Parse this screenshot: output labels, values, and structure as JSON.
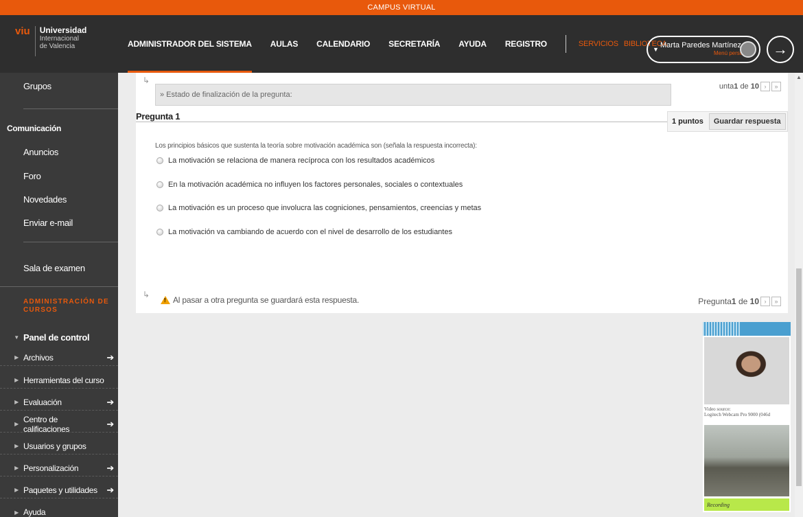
{
  "topbar": {
    "title": "CAMPUS VIRTUAL"
  },
  "logo": {
    "mark": "viu",
    "line1": "Universidad",
    "line2": "Internacional",
    "line3": "de Valencia"
  },
  "nav": {
    "items": [
      "ADMINISTRADOR DEL SISTEMA",
      "AULAS",
      "CALENDARIO",
      "SECRETARÍA",
      "AYUDA",
      "REGISTRO"
    ],
    "extras": [
      "SERVICIOS",
      "BIBLIOTECA"
    ]
  },
  "user": {
    "name": "Marta Paredes Martínez",
    "menu": "Menú personal"
  },
  "sidebar": {
    "groups_link": "Grupos",
    "comms_heading": "Comunicación",
    "comms": [
      "Anuncios",
      "Foro",
      "Novedades",
      "Enviar e-mail"
    ],
    "exam_room": "Sala de examen",
    "admin_heading": "ADMINISTRACIÓN DE CURSOS",
    "control_panel": "Panel de control",
    "cp_items": [
      {
        "label": "Archivos",
        "has_arrow": true
      },
      {
        "label": "Herramientas del curso",
        "has_arrow": false
      },
      {
        "label": "Evaluación",
        "has_arrow": true
      },
      {
        "label": "Centro de calificaciones",
        "has_arrow": true
      },
      {
        "label": "Usuarios y grupos",
        "has_arrow": false
      },
      {
        "label": "Personalización",
        "has_arrow": true
      },
      {
        "label": "Paquetes y utilidades",
        "has_arrow": true
      },
      {
        "label": "Ayuda",
        "has_arrow": false
      }
    ]
  },
  "question": {
    "status_label": "» Estado de finalización de la pregunta:",
    "nav_top_prefix": "unta",
    "nav_bottom_prefix": "Pregunta",
    "current": "1",
    "of_word": "de",
    "total": "10",
    "title": "Pregunta 1",
    "points": "1 puntos",
    "save_button": "Guardar respuesta",
    "prompt": "Los principios básicos que sustenta la teoría sobre motivación académica son (señala la respuesta incorrecta):",
    "options": [
      "La motivación se relaciona de manera recíproca con los resultados académicos",
      "En la motivación académica no influyen los factores personales, sociales o contextuales",
      "La motivación es un proceso que involucra las cogniciones, pensamientos, creencias y metas",
      "La motivación va cambiando de acuerdo con el nivel de desarrollo de los estudiantes"
    ],
    "warning": "Al pasar a otra pregunta se guardará esta respuesta."
  },
  "proctor": {
    "video_source_label": "Video source:",
    "video_source_value": "Logitech Webcam Pro 9000 (046d",
    "recording": "Recording"
  },
  "colors": {
    "accent": "#e8590c",
    "header_bg": "#2e2e2e",
    "sidebar_bg": "#3a3a3a"
  },
  "icons": {
    "logout": "logout-arrow-icon",
    "warning": "warning-triangle-icon",
    "radio": "radio-icon"
  }
}
